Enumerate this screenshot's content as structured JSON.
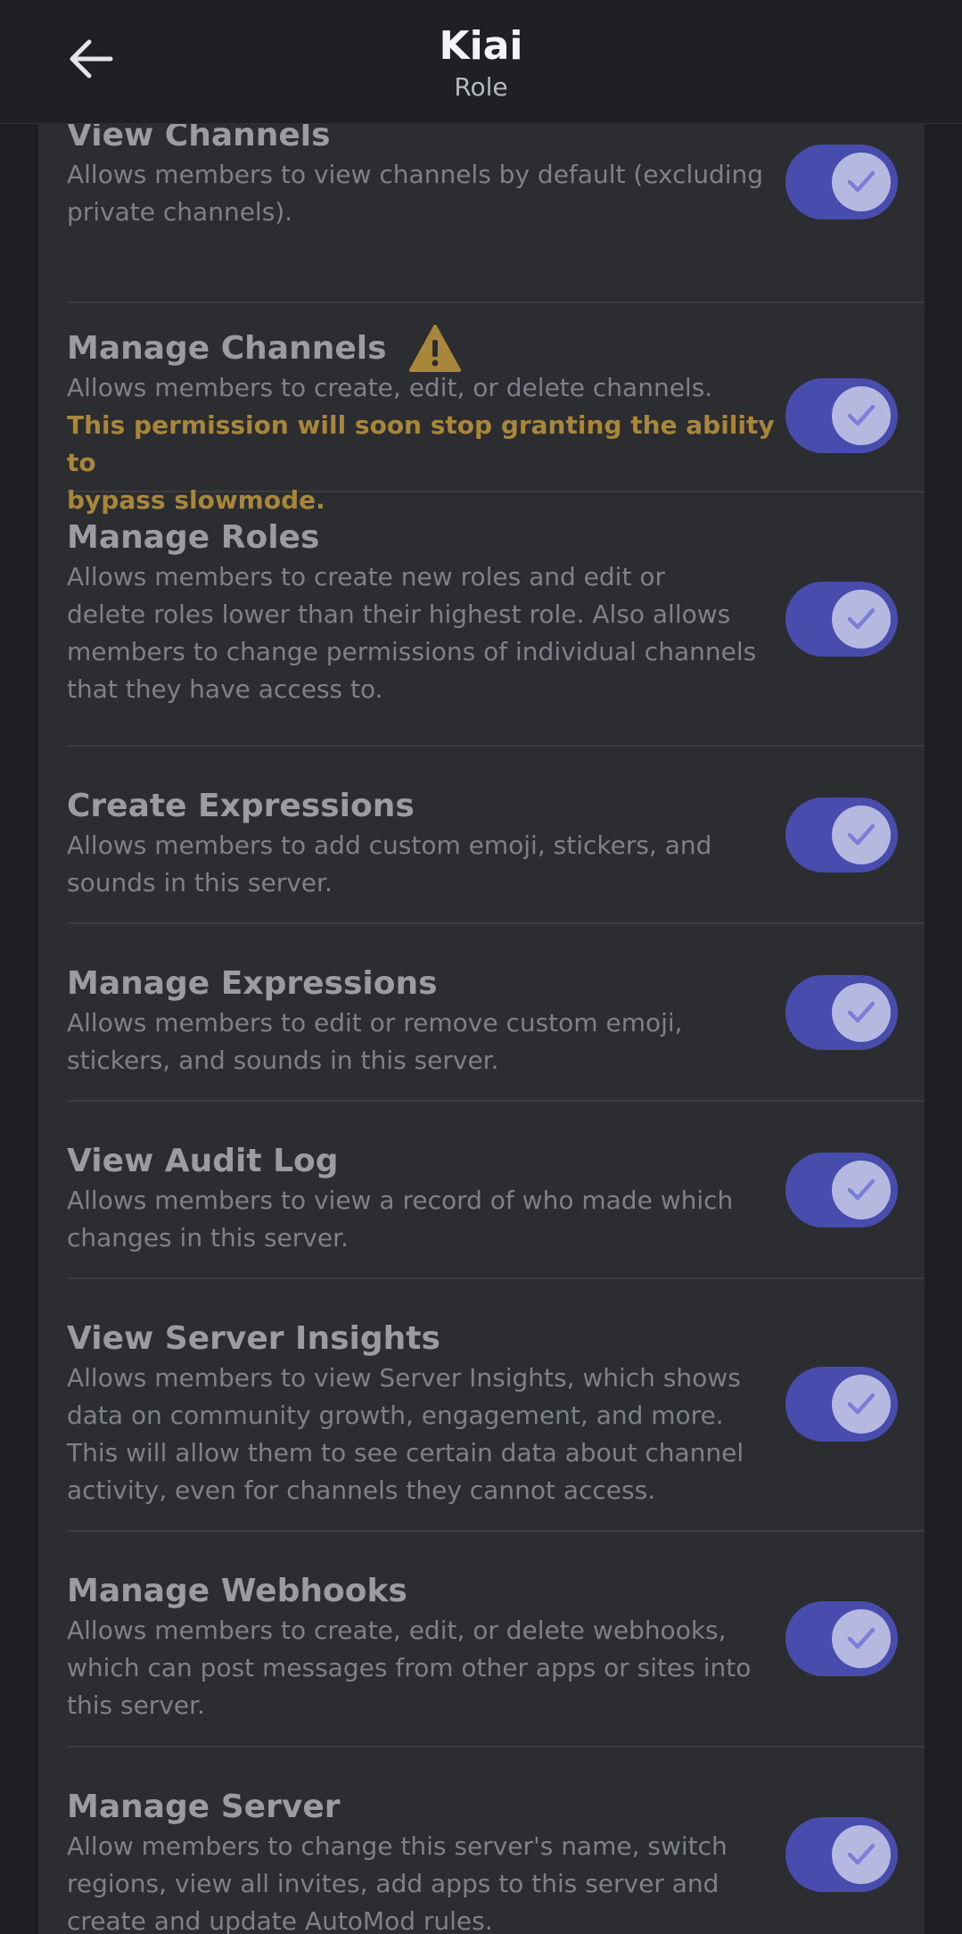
{
  "header": {
    "title": "Kiai",
    "subtitle": "Role"
  },
  "permissions": [
    {
      "title": "View Channels",
      "description": [
        "Allows members to view channels by default (excluding",
        "private channels)."
      ],
      "enabled": true
    },
    {
      "title": "Manage Channels",
      "description": [
        "Allows members to create, edit, or delete channels."
      ],
      "warning": [
        "This permission will soon stop granting the ability to",
        "bypass slowmode."
      ],
      "has_warning_icon": true,
      "enabled": true
    },
    {
      "title": "Manage Roles",
      "description": [
        "Allows members to create new roles and edit or",
        "delete roles lower than their highest role. Also allows",
        "members to change permissions of individual channels",
        "that they have access to."
      ],
      "enabled": true
    },
    {
      "title": "Create Expressions",
      "description": [
        "Allows members to add custom emoji, stickers, and",
        "sounds in this server."
      ],
      "enabled": true
    },
    {
      "title": "Manage Expressions",
      "description": [
        "Allows members to edit or remove custom emoji,",
        "stickers, and sounds in this server."
      ],
      "enabled": true
    },
    {
      "title": "View Audit Log",
      "description": [
        "Allows members to view a record of who made which",
        "changes in this server."
      ],
      "enabled": true
    },
    {
      "title": "View Server Insights",
      "description": [
        "Allows members to view Server Insights, which shows",
        "data on community growth, engagement, and more.",
        "This will allow them to see certain data about channel",
        "activity, even for channels they cannot access."
      ],
      "enabled": true
    },
    {
      "title": "Manage Webhooks",
      "description": [
        "Allows members to create, edit, or delete webhooks,",
        "which can post messages from other apps or sites into",
        "this server."
      ],
      "enabled": true
    },
    {
      "title": "Manage Server",
      "description": [
        "Allow members to change this server's name, switch",
        "regions, view all invites, add apps to this server and",
        "create and update AutoMod rules."
      ],
      "enabled": true
    }
  ],
  "colors": {
    "toggle_on": "#474cad",
    "warning": "#a8873a",
    "background": "#2b2d31"
  }
}
